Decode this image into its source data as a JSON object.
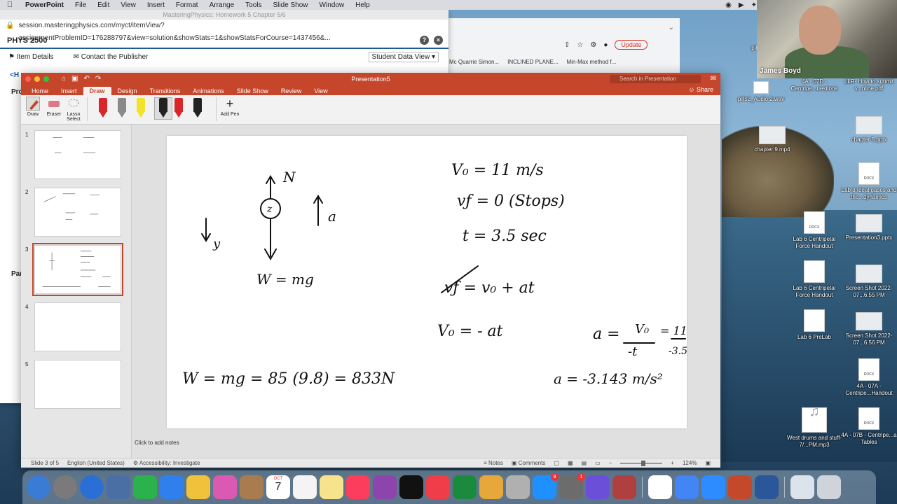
{
  "menubar": {
    "app": "PowerPoint",
    "items": [
      "File",
      "Edit",
      "View",
      "Insert",
      "Format",
      "Arrange",
      "Tools",
      "Slide Show",
      "Window",
      "Help"
    ]
  },
  "browser": {
    "title": "MasteringPhysics: Homework 5 Chapter 5/6",
    "url": "session.masteringphysics.com/myct/itemView?assignmentProblemID=176288797&view=solution&showStats=1&showStatsForCourse=1437456&...",
    "course": "PHYS 2500",
    "item_details": "Item Details",
    "contact_publisher": "Contact the Publisher",
    "student_view": "Student Data View",
    "side_frag_1": "<H",
    "side_frag_2": "Pro",
    "side_frag_3": "Par"
  },
  "chrome": {
    "update": "Update",
    "bookmarks": [
      "Mc Quarrie Simon...",
      "INCLINED PLANE...",
      "Min-Max method f..."
    ]
  },
  "ppt": {
    "doc_title": "Presentation5",
    "search_placeholder": "Search in Presentation",
    "share": "Share",
    "tabs": [
      "Home",
      "Insert",
      "Draw",
      "Design",
      "Transitions",
      "Animations",
      "Slide Show",
      "Review",
      "View"
    ],
    "active_tab": "Draw",
    "tools": {
      "draw": "Draw",
      "eraser": "Eraser",
      "lasso_1": "Lasso",
      "lasso_2": "Select",
      "add_pen": "Add Pen"
    },
    "pen_colors": [
      "#d8262a",
      "#8a8a8a",
      "#f2e22a",
      "#222222",
      "#d8262a",
      "#222222"
    ],
    "thumbnails": [
      "1",
      "2",
      "3",
      "4",
      "5"
    ],
    "active_slide": "3",
    "notes_placeholder": "Click to add notes",
    "status": {
      "slide": "Slide 3 of 5",
      "language": "English (United States)",
      "accessibility": "Accessibility: Investigate",
      "notes": "Notes",
      "comments": "Comments",
      "zoom": "124%"
    }
  },
  "slide": {
    "n": "N",
    "mass_label": "z",
    "accel": "a",
    "y": "y",
    "weight": "W = mg",
    "v0": "V₀ = 11 m/s",
    "vf": "vƒ = 0   (Stops)",
    "t": "t =   3.5 sec",
    "eq1": "vƒ = v₀ + at",
    "eq2": "V₀ = - at",
    "a_eq": "a =",
    "a_num": "V₀",
    "a_den": "-t",
    "a_rhs_num": "= 11",
    "a_rhs_den": "-3.5",
    "w_eq": "W = mg = 85 (9.8) = 833N",
    "a_result": "a = -3.143 m/s²"
  },
  "webcam": {
    "name": "James Boyd"
  },
  "desktop": [
    "pills_A",
    "pills2_Audio 2.wav",
    "4A - 07D - Centripe...uestions",
    "LLR- How to submit v...nline.pdf",
    "chapter 9.mp4",
    "chapter 5.pptx",
    "Lab 3 Ideal gases and the...dynamics",
    "Lab 6 Centripetal Force Handout",
    "Presentation3.pptx",
    "Lab 6 Centripetal Force Handout",
    "Screen Shot 2022-07...6.55 PM",
    "Lab 6 PreLab",
    "Screen Shot 2022-07...6.56 PM",
    "4A - 07A - Centripe...Handout",
    "West drums and stuff- 7/...PM.mp3",
    "4A - 07B - Centripe...a Tables"
  ],
  "dock": {
    "calendar_month": "OCT",
    "calendar_day": "7",
    "badge_appstore": "9",
    "badge_settings": "1",
    "colors": [
      "#3a7bd5",
      "#7a7a7a",
      "#2a6fd6",
      "#4a6fa5",
      "#2bb24c",
      "#2f80ed",
      "#f0c23b",
      "#d95ab0",
      "#a87c4f",
      "#ffffff",
      "#f4f4f4",
      "#f7e38b",
      "#fc3d5b",
      "#8e44ad",
      "#111111",
      "#ef3e4a",
      "#1b8a3d",
      "#e6a83a",
      "#b0b0b0",
      "#1e90ff",
      "#6c6c6c",
      "#6b4fd8",
      "#b04040",
      "#ffffff",
      "#4285f4",
      "#2d8cff",
      "#c4482a",
      "#2b579a",
      "#dde3ea",
      "#cfd4da"
    ]
  }
}
